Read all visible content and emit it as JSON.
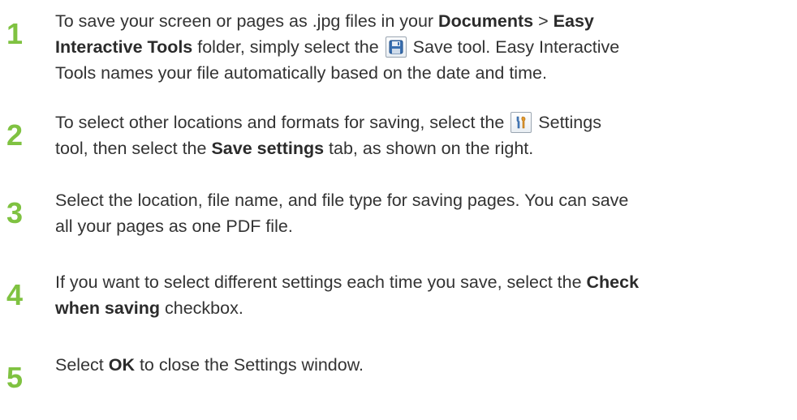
{
  "steps": [
    {
      "number": "1",
      "line1_a": "To save your screen or pages as .jpg files in your ",
      "line1_b": "Documents",
      "line1_c": " > ",
      "line1_d": "Easy",
      "line2_a": "Interactive Tools",
      "line2_b": " folder, simply select the ",
      "icon": "save-icon",
      "line2_c": " Save tool. Easy Interactive",
      "line3": "Tools names your file automatically based on the date and time."
    },
    {
      "number": "2",
      "line1_a": "To select other locations and formats for saving, select the ",
      "icon": "settings-icon",
      "line1_b": " Settings",
      "line2_a": "tool, then select the ",
      "line2_b": "Save settings",
      "line2_c": " tab, as shown on the right."
    },
    {
      "number": "3",
      "line1": "Select the location, file name, and file type for saving pages. You can save",
      "line2": "all your pages as one PDF file."
    },
    {
      "number": "4",
      "line1_a": "If you want to select different settings each time you save, select the ",
      "line1_b": "Check",
      "line2_a": "when saving",
      "line2_b": " checkbox."
    },
    {
      "number": "5",
      "line1_a": "Select ",
      "line1_b": "OK",
      "line1_c": " to close the Settings window."
    }
  ],
  "colors": {
    "step_number": "#7fc241",
    "text": "#333333"
  }
}
